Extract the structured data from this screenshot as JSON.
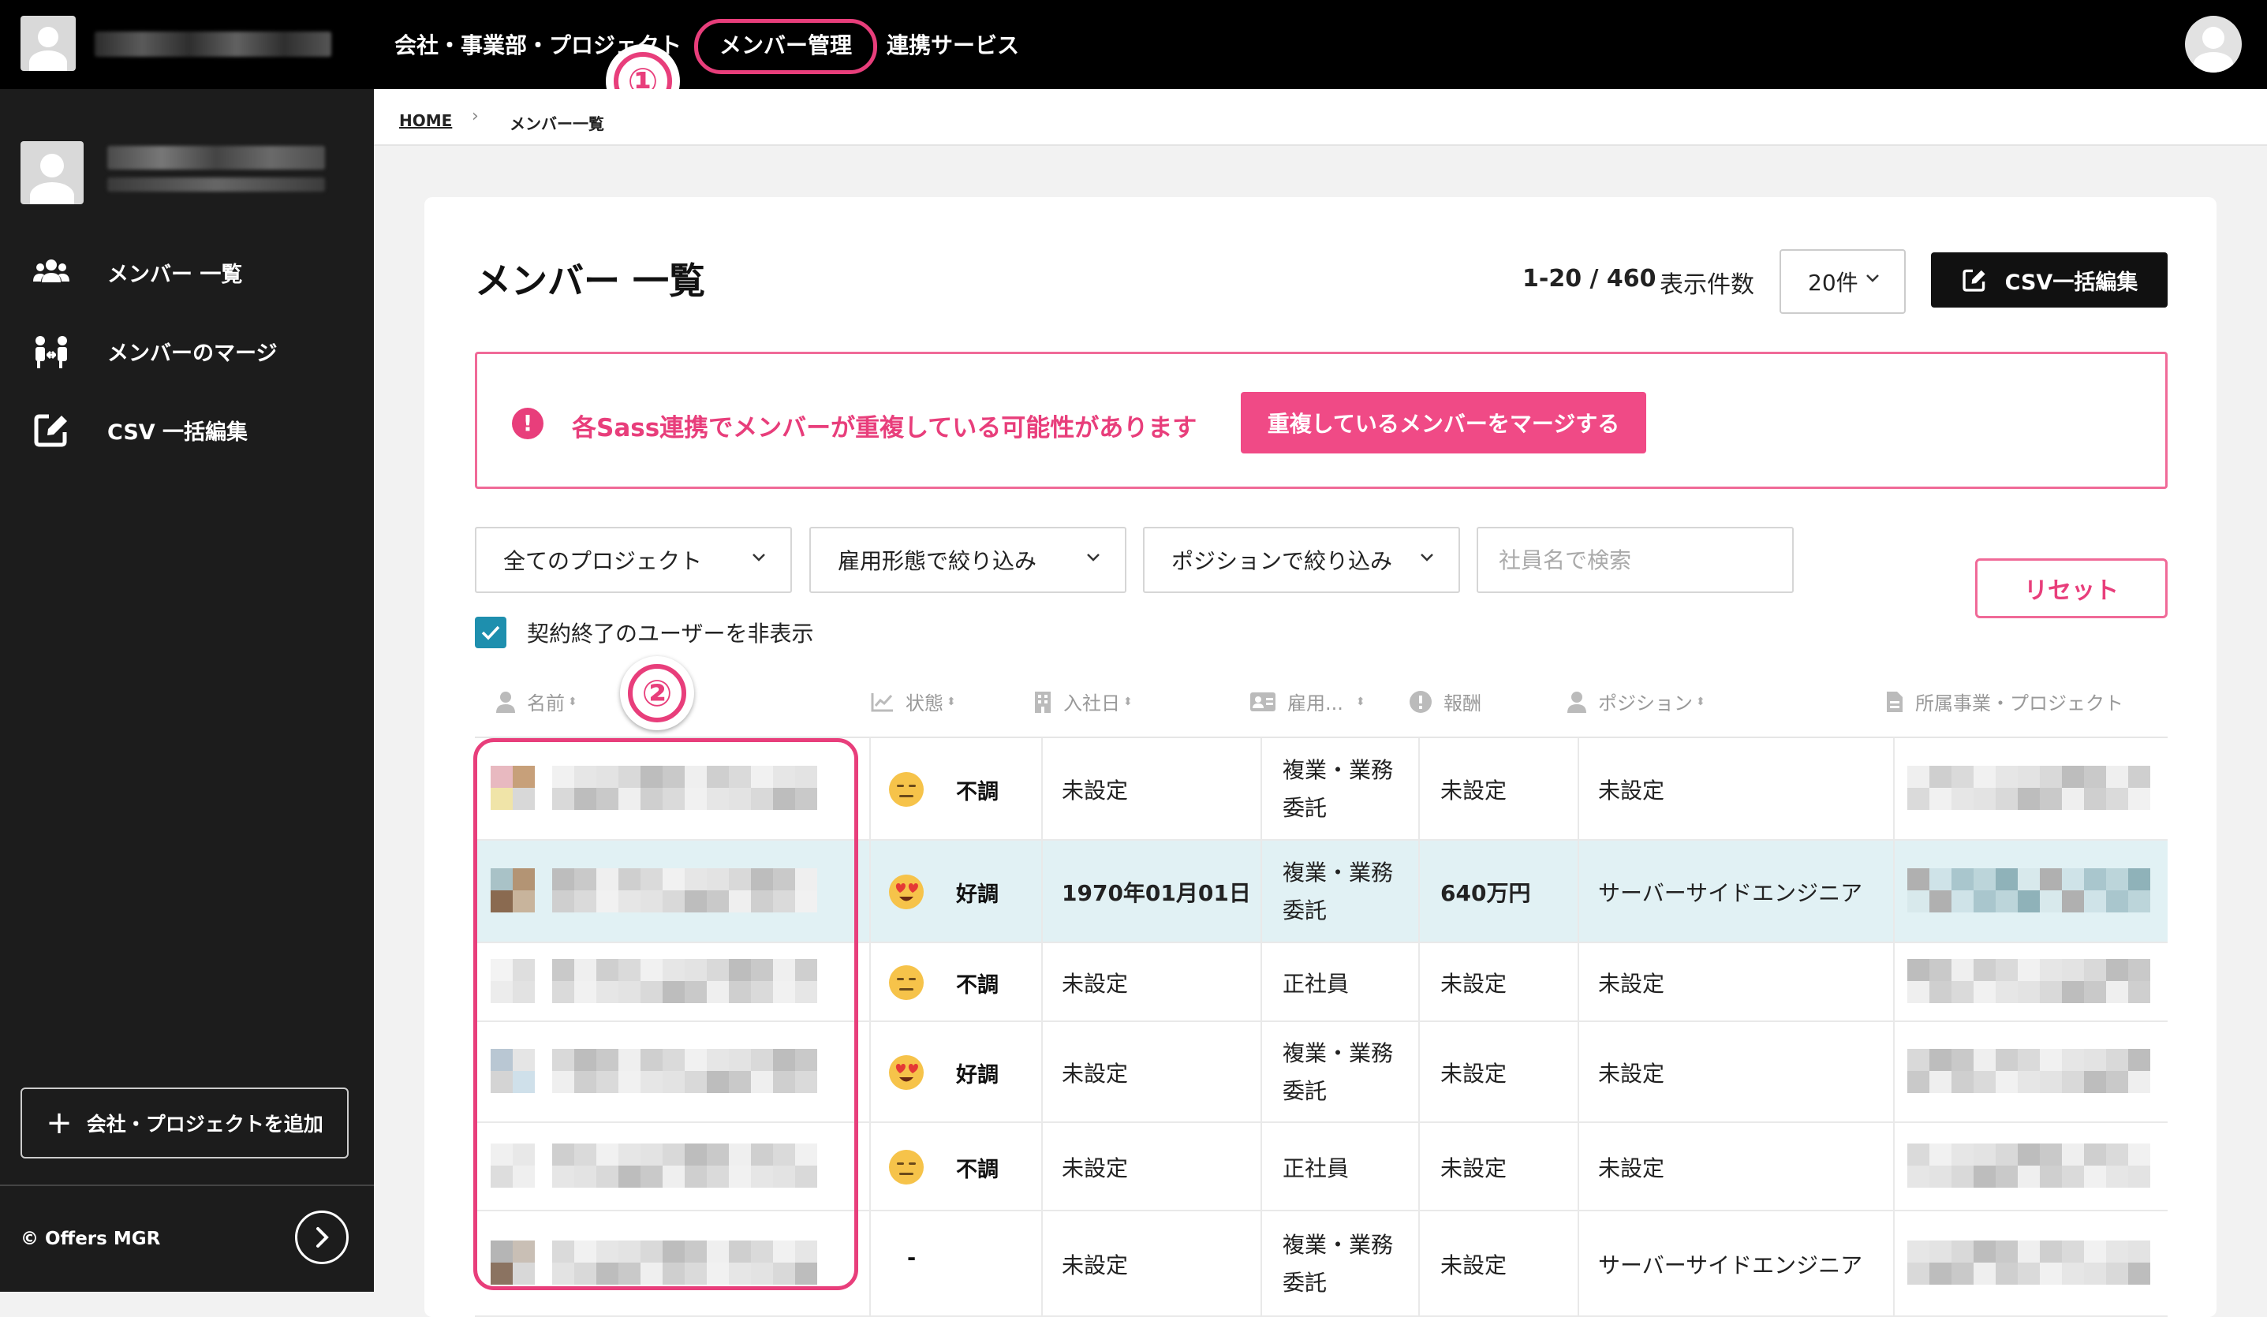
{
  "topnav": {
    "items": [
      "会社・事業部・プロジェクト",
      "メンバー管理",
      "連携サービス"
    ],
    "markers": [
      "①",
      "②"
    ]
  },
  "breadcrumb": {
    "home": "HOME",
    "current": "メンバー一覧"
  },
  "sidebar": {
    "items": [
      {
        "label": "メンバー 一覧",
        "icon": "group-icon"
      },
      {
        "label": "メンバーのマージ",
        "icon": "merge-users-icon"
      },
      {
        "label": "CSV 一括編集",
        "icon": "edit-square-icon"
      }
    ],
    "add_button": "会社・プロジェクトを追加",
    "copyright": "© Offers MGR"
  },
  "header": {
    "title": "メンバー 一覧",
    "count": "1-20 / 460",
    "per_page_label": "表示件数",
    "per_page_value": "20件",
    "csv_button": "CSV一括編集"
  },
  "alert": {
    "icon": "!",
    "message": "各Sass連携でメンバーが重複している可能性があります",
    "button": "重複しているメンバーをマージする"
  },
  "filters": {
    "project": "全てのプロジェクト",
    "employment": "雇用形態で絞り込み",
    "position": "ポジションで絞り込み",
    "search_placeholder": "社員名で検索",
    "reset": "リセット",
    "hide_terminated": "契約終了のユーザーを非表示",
    "hide_terminated_checked": true
  },
  "table": {
    "columns": [
      "名前",
      "状態",
      "入社日",
      "雇用...",
      "報酬",
      "ポジション",
      "所属事業・プロジェクト"
    ],
    "sort_indicator": "⬍",
    "rows": [
      {
        "status_icon": "neutral-face-icon",
        "status": "不調",
        "join_date": "未設定",
        "employment": [
          "複業・業務",
          "委託"
        ],
        "salary": "未設定",
        "position": "未設定"
      },
      {
        "status_icon": "heart-eyes-icon",
        "status": "好調",
        "join_date": "1970年01月01日",
        "employment": [
          "複業・業務",
          "委託"
        ],
        "salary": "640万円",
        "position": "サーバーサイドエンジニア",
        "highlighted": true
      },
      {
        "status_icon": "neutral-face-icon",
        "status": "不調",
        "join_date": "未設定",
        "employment": [
          "正社員"
        ],
        "salary": "未設定",
        "position": "未設定"
      },
      {
        "status_icon": "heart-eyes-icon",
        "status": "好調",
        "join_date": "未設定",
        "employment": [
          "複業・業務",
          "委託"
        ],
        "salary": "未設定",
        "position": "未設定"
      },
      {
        "status_icon": "neutral-face-icon",
        "status": "不調",
        "join_date": "未設定",
        "employment": [
          "正社員"
        ],
        "salary": "未設定",
        "position": "未設定"
      },
      {
        "status_icon": null,
        "status": "-",
        "join_date": "未設定",
        "employment": [
          "複業・業務",
          "委託"
        ],
        "salary": "未設定",
        "position": "サーバーサイドエンジニア"
      }
    ]
  },
  "colors": {
    "accent_pink": "#e83e7b",
    "checkbox_blue": "#1e8fae",
    "highlight_row": "#e1f1f4",
    "sidebar_bg": "#1c1c1c"
  }
}
